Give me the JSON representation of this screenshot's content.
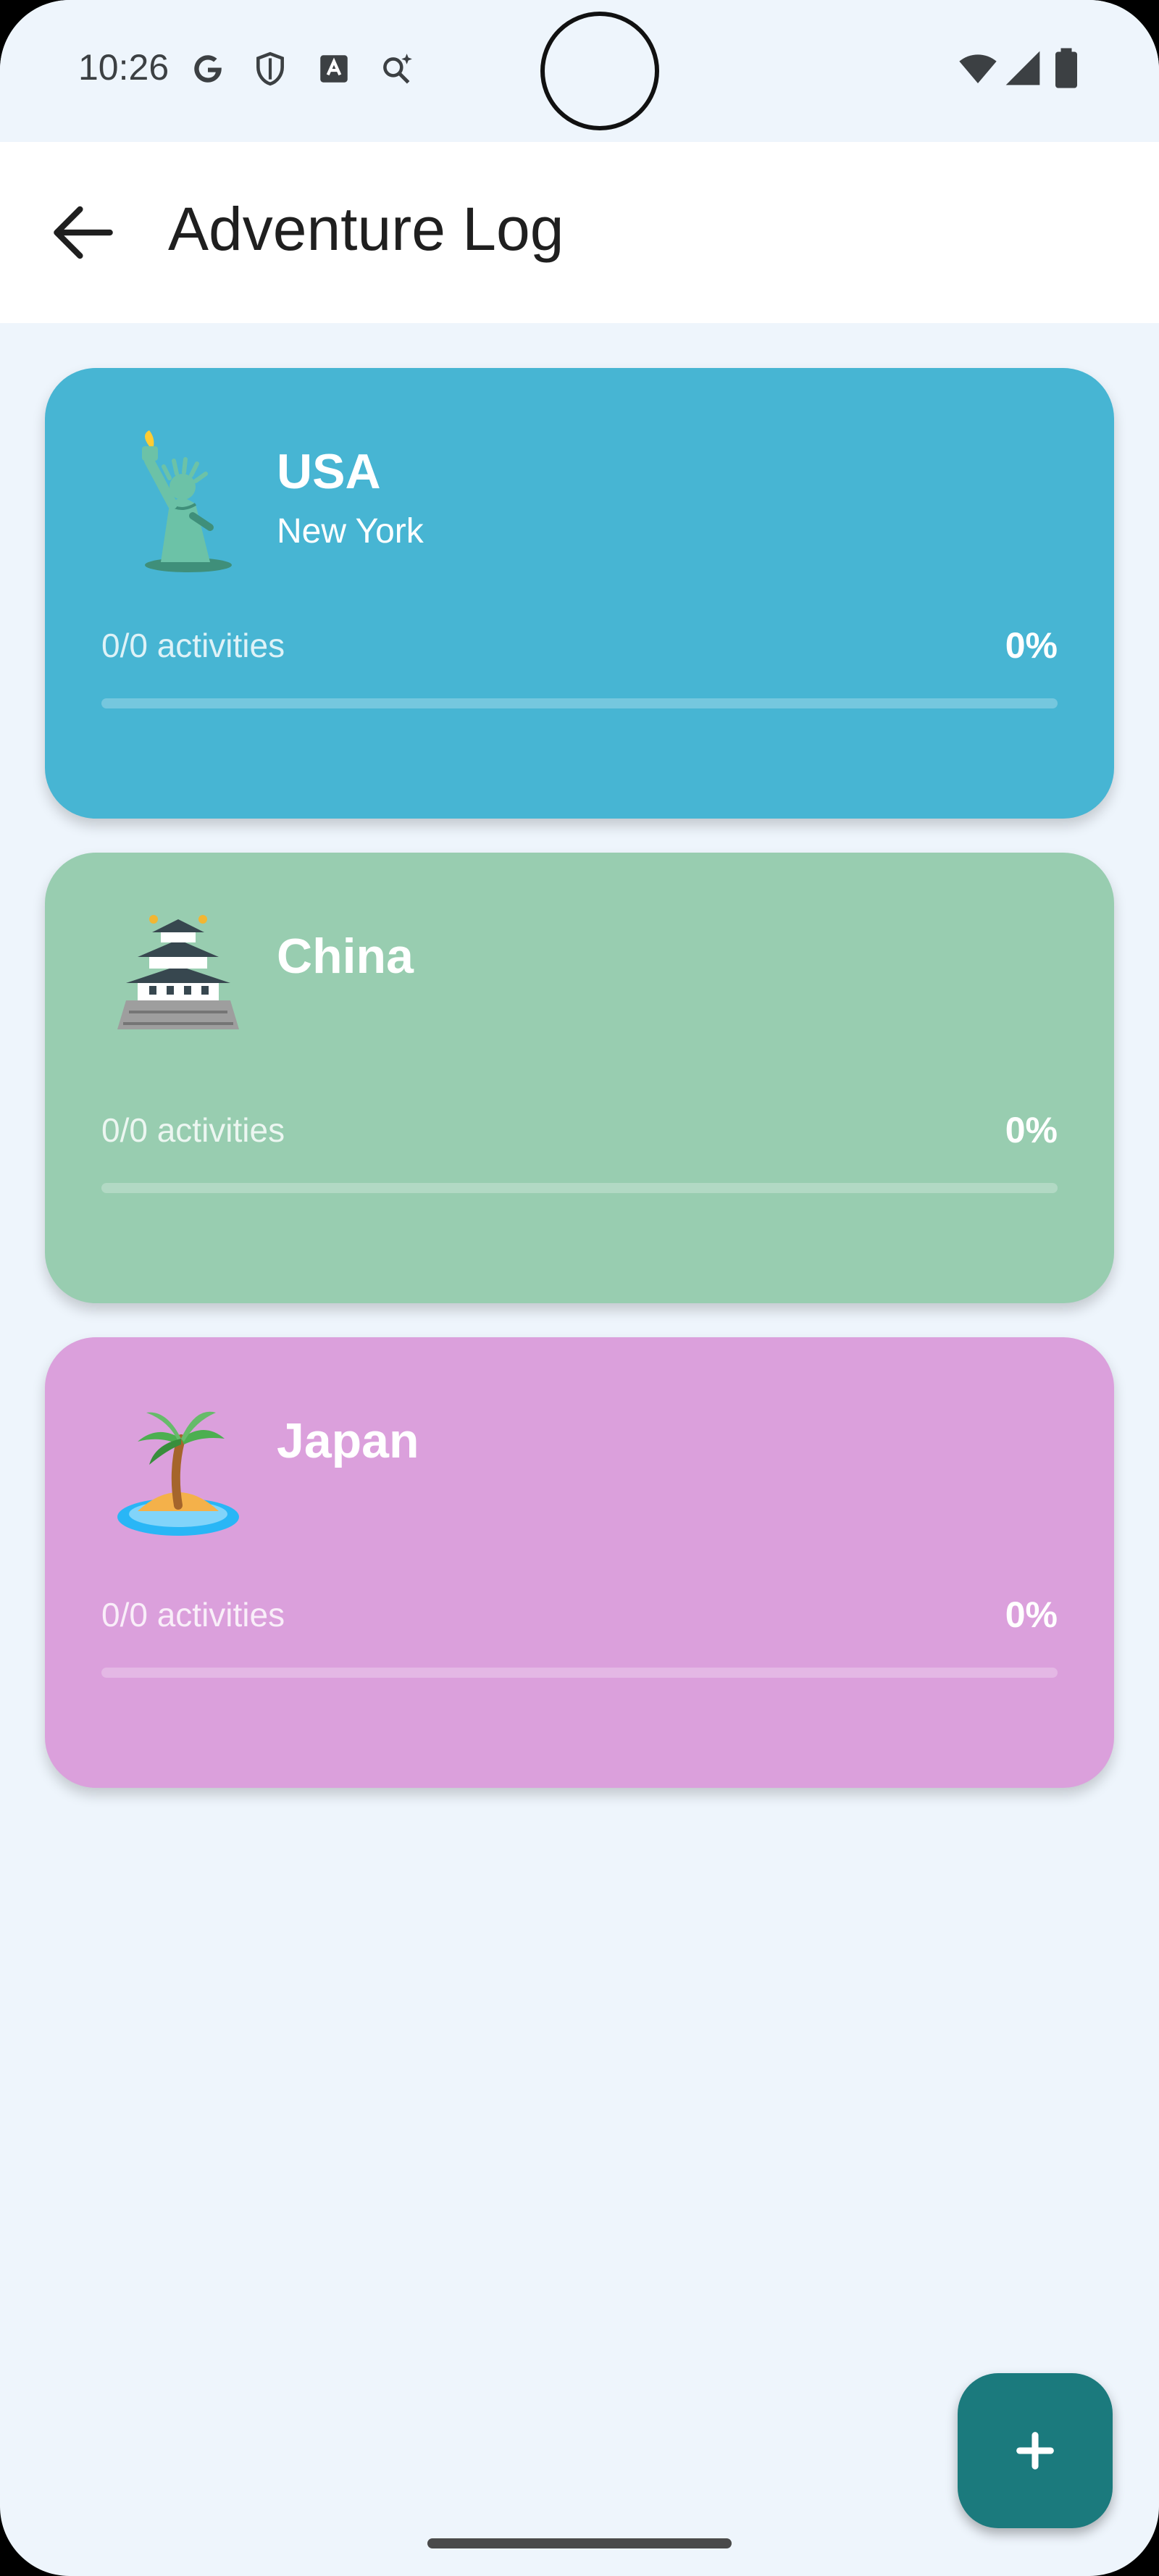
{
  "status_bar": {
    "time": "10:26",
    "left_icons": [
      "google-icon",
      "shield-icon",
      "font-a-icon",
      "search-spark-icon"
    ],
    "right_icons": [
      "wifi-icon",
      "signal-icon",
      "battery-icon"
    ]
  },
  "app_bar": {
    "title": "Adventure Log",
    "back_icon": "arrow-back-icon"
  },
  "cards": [
    {
      "title": "USA",
      "subtitle": "New York",
      "emoji": "statue-of-liberty-icon",
      "activities": "0/0 activities",
      "percent": "0%",
      "progress": 0,
      "color": "#47b5d3"
    },
    {
      "title": "China",
      "subtitle": "",
      "emoji": "japanese-castle-icon",
      "activities": "0/0 activities",
      "percent": "0%",
      "progress": 0,
      "color": "#98cdb0"
    },
    {
      "title": "Japan",
      "subtitle": "",
      "emoji": "desert-island-icon",
      "activities": "0/0 activities",
      "percent": "0%",
      "progress": 0,
      "color": "#dba0dc"
    }
  ],
  "fab": {
    "icon": "plus-icon",
    "color": "#1b7a7d"
  }
}
